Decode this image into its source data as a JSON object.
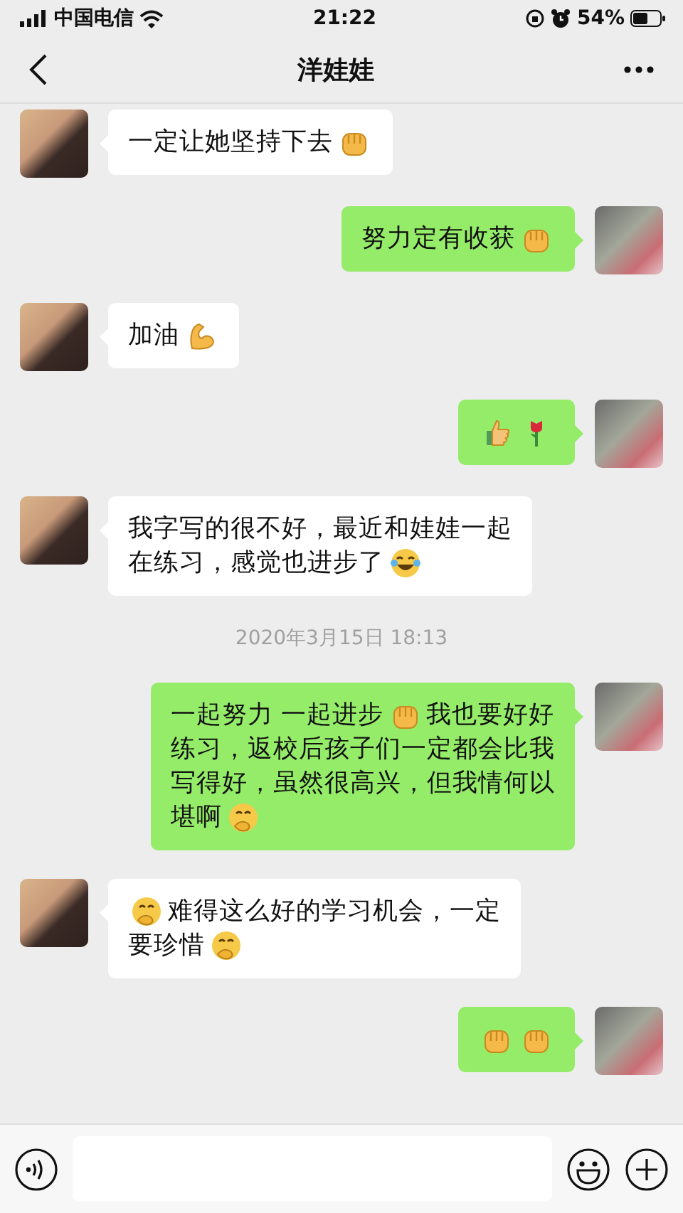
{
  "status_bar": {
    "carrier": "中国电信",
    "time": "21:22",
    "battery": "54%"
  },
  "header": {
    "title": "洋娃娃"
  },
  "messages": [
    {
      "kind": "message",
      "outgoing": false,
      "lines": [
        [
          {
            "kind": "text",
            "text": "一定让她坚持下去"
          },
          {
            "kind": "fist"
          }
        ]
      ]
    },
    {
      "kind": "message",
      "outgoing": true,
      "lines": [
        [
          {
            "kind": "text",
            "text": "努力定有收获"
          },
          {
            "kind": "fist"
          }
        ]
      ]
    },
    {
      "kind": "message",
      "outgoing": false,
      "lines": [
        [
          {
            "kind": "text",
            "text": "加油"
          },
          {
            "kind": "muscle"
          }
        ]
      ]
    },
    {
      "kind": "message",
      "outgoing": true,
      "lines": [
        [
          {
            "kind": "thumbs"
          },
          {
            "kind": "rose"
          }
        ]
      ]
    },
    {
      "kind": "message",
      "outgoing": false,
      "lines": [
        [
          {
            "kind": "text",
            "text": "我字写的很不好，最近和娃娃一起"
          }
        ],
        [
          {
            "kind": "text",
            "text": "在练习，感觉也进步了"
          },
          {
            "kind": "laugh"
          }
        ]
      ]
    },
    {
      "kind": "time",
      "text": "2020年3月15日 18:13"
    },
    {
      "kind": "message",
      "outgoing": true,
      "lines": [
        [
          {
            "kind": "text",
            "text": "一起努力 一起进步"
          },
          {
            "kind": "fist"
          },
          {
            "kind": "text",
            "text": "我也要好好"
          }
        ],
        [
          {
            "kind": "text",
            "text": "练习，返校后孩子们一定都会比我"
          }
        ],
        [
          {
            "kind": "text",
            "text": "写得好，虽然很高兴，但我情何以"
          }
        ],
        [
          {
            "kind": "text",
            "text": "堪啊"
          },
          {
            "kind": "grin"
          }
        ]
      ]
    },
    {
      "kind": "message",
      "outgoing": false,
      "lines": [
        [
          {
            "kind": "grin"
          },
          {
            "kind": "text",
            "text": "难得这么好的学习机会，一定"
          }
        ],
        [
          {
            "kind": "text",
            "text": "要珍惜"
          },
          {
            "kind": "grin"
          }
        ]
      ]
    },
    {
      "kind": "message",
      "outgoing": true,
      "lines": [
        [
          {
            "kind": "fist"
          },
          {
            "kind": "fist"
          }
        ]
      ]
    }
  ]
}
